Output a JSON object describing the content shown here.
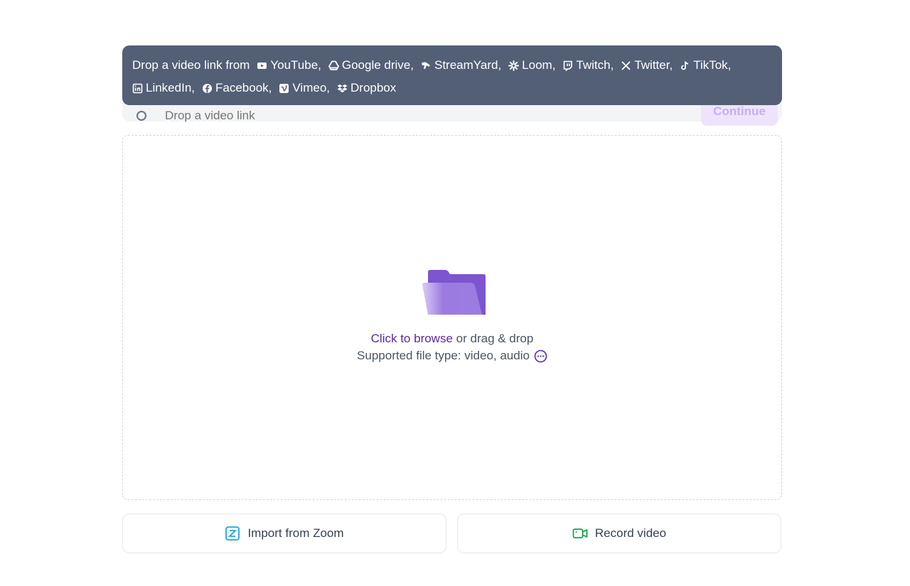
{
  "link_input": {
    "placeholder": "Drop a video link",
    "continue_label": "Continue"
  },
  "tooltip": {
    "lead": "Drop a video link from",
    "sources_line1": [
      {
        "label": "YouTube,",
        "icon": "youtube-icon"
      },
      {
        "label": "Google drive,",
        "icon": "google-drive-icon"
      },
      {
        "label": "StreamYard,",
        "icon": "streamyard-icon"
      },
      {
        "label": "Loom,",
        "icon": "loom-icon"
      },
      {
        "label": "Twitch,",
        "icon": "twitch-icon"
      },
      {
        "label": "Twitter,",
        "icon": "twitter-x-icon"
      },
      {
        "label": "TikTok,",
        "icon": "tiktok-icon"
      }
    ],
    "sources_line2": [
      {
        "label": "LinkedIn,",
        "icon": "linkedin-icon"
      },
      {
        "label": "Facebook,",
        "icon": "facebook-icon"
      },
      {
        "label": "Vimeo,",
        "icon": "vimeo-icon"
      },
      {
        "label": "Dropbox",
        "icon": "dropbox-icon"
      }
    ]
  },
  "dropzone": {
    "browse_link": "Click to browse",
    "browse_rest": "or drag & drop",
    "supported": "Supported file type: video, audio"
  },
  "buttons": {
    "zoom_label": "Import from Zoom",
    "record_label": "Record video"
  },
  "colors": {
    "tooltip_bg": "#525f75",
    "accent_purple": "#5b2a9e",
    "folder_purple": "#7c55cf",
    "zoom_blue": "#1fa6d9",
    "record_green": "#16a34a"
  }
}
